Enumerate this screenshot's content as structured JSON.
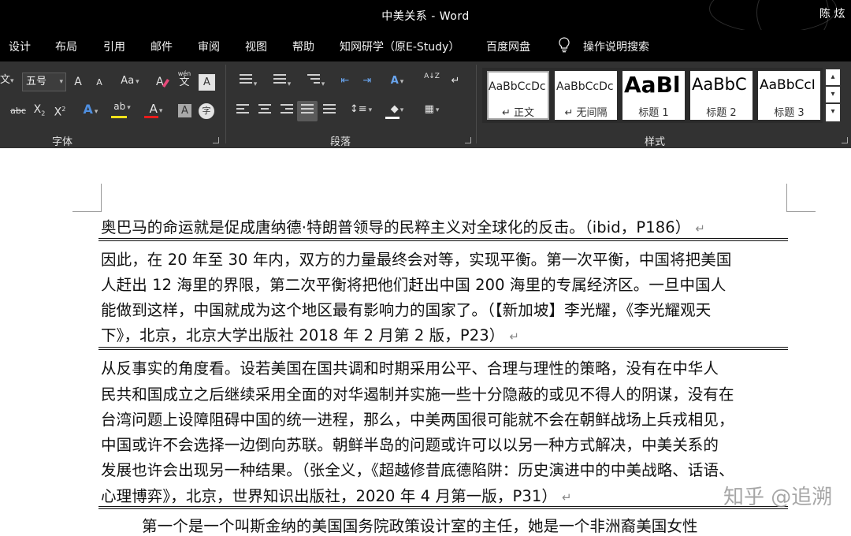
{
  "window": {
    "title": "中美关系  -  Word",
    "user": "陈 炫"
  },
  "tabs": [
    "设计",
    "布局",
    "引用",
    "邮件",
    "审阅",
    "视图",
    "帮助",
    "知网研学（原E-Study）",
    "百度网盘",
    "操作说明搜索"
  ],
  "ribbon": {
    "font": {
      "name_partial": "文",
      "size": "五号",
      "grow": "A",
      "shrink": "A",
      "change_case": "Aa",
      "phonetic": "wén",
      "phonetic_base": "文",
      "char_border": "A",
      "strike": "abc",
      "subscript": "X",
      "subscript_mark": "2",
      "superscript": "X",
      "superscript_mark": "2",
      "effects": "A",
      "highlight": "ab",
      "font_color": "A",
      "shading": "A",
      "enclose": "字",
      "label": "字体",
      "highlight_color": "#f5e21b",
      "font_color_value": "#e81c1c"
    },
    "paragraph": {
      "label": "段落",
      "sort": "A↓Z"
    },
    "styles": {
      "label": "样式",
      "items": [
        {
          "sample": "AaBbCcDc",
          "name": "↵ 正文"
        },
        {
          "sample": "AaBbCcDc",
          "name": "↵ 无间隔"
        },
        {
          "sample": "AaBl",
          "name": "标题 1"
        },
        {
          "sample": "AaBbC",
          "name": "标题 2"
        },
        {
          "sample": "AaBbCcI",
          "name": "标题 3"
        }
      ]
    }
  },
  "document": {
    "lines": [
      "奥巴马的命运就是促成唐纳德·特朗普领导的民粹主义对全球化的反击。（ibid，P186）",
      "因此，在 20 年至 30 年内，双方的力量最终会对等，实现平衡。第一次平衡，中国将把美国",
      "人赶出 12 海里的界限，第二次平衡将把他们赶出中国 200 海里的专属经济区。一旦中国人",
      "能做到这样，中国就成为这个地区最有影响力的国家了。（【新加坡】李光耀，《李光耀观天",
      "下》，北京，北京大学出版社 2018 年 2 月第 2 版，P23）",
      "从反事实的角度看。设若美国在国共调和时期采用公平、合理与理性的策略，没有在中华人",
      "民共和国成立之后继续采用全面的对华遏制并实施一些十分隐蔽的或见不得人的阴谋，没有在",
      "台湾问题上设障阻碍中国的统一进程，那么，中美两国很可能就不会在朝鲜战场上兵戎相见，",
      "中国或许不会选择一边倒向苏联。朝鲜半岛的问题或许可以以另一种方式解决，中美关系的",
      "发展也许会出现另一种结果。（张全义，《超越修昔底德陷阱：历史演进中的中美战略、话语、",
      "心理博弈》，北京，世界知识出版社，2020 年 4 月第一版，P31）",
      "第一个是一个叫斯金纳的美国国务院政策设计室的主任，她是一个非洲裔美国女性"
    ],
    "paragraph_mark": "↵",
    "watermark": "知乎 @追溯"
  }
}
